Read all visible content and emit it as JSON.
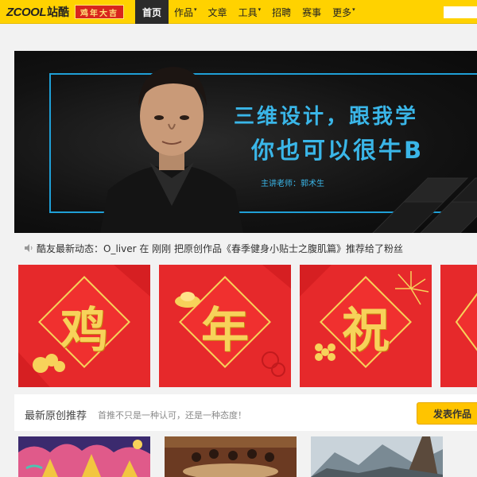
{
  "header": {
    "logo_en": "ZCOOL",
    "logo_cn": "站酷",
    "badge": "鸡年大吉",
    "nav": [
      {
        "label": "首页",
        "active": true,
        "caret": false
      },
      {
        "label": "作品",
        "active": false,
        "caret": true
      },
      {
        "label": "文章",
        "active": false,
        "caret": false
      },
      {
        "label": "工具",
        "active": false,
        "caret": true
      },
      {
        "label": "招聘",
        "active": false,
        "caret": false
      },
      {
        "label": "赛事",
        "active": false,
        "caret": false
      },
      {
        "label": "更多",
        "active": false,
        "caret": true
      }
    ],
    "caret_glyph": "▾"
  },
  "banner": {
    "line1": "三维设计，跟我学",
    "line2": "你也可以很牛B",
    "teacher": "主讲老师：郭术生",
    "accent": "#3ab6e8"
  },
  "news": {
    "text": "酷友最新动态：O_liver 在 刚刚 把原创作品《春季健身小贴士之腹肌篇》推荐给了粉丝"
  },
  "tiles": [
    {
      "glyph": "鸡"
    },
    {
      "glyph": "年"
    },
    {
      "glyph": "祝"
    },
    {
      "glyph": ""
    }
  ],
  "recommend": {
    "title": "最新原创推荐",
    "subtitle": "首推不只是一种认可，还是一种态度！",
    "publish_label": "发表作品"
  },
  "colors": {
    "brand_yellow": "#ffd200",
    "festive_red": "#e6292b",
    "gold": "#f7d25a"
  }
}
